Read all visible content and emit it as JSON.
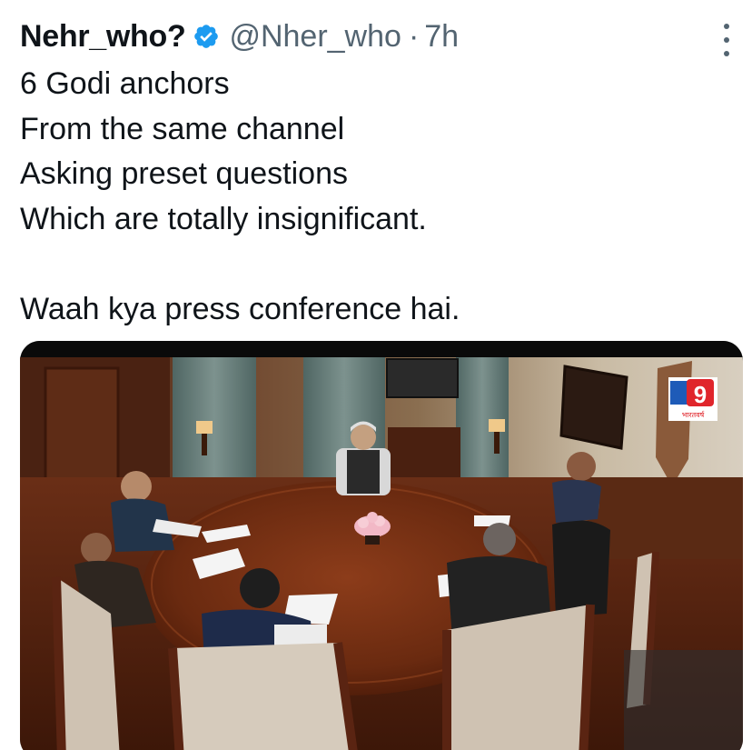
{
  "tweet": {
    "author": {
      "display_name": "Nehr_who?",
      "handle": "@Nher_who",
      "verified": true,
      "verified_icon": "verified-badge-icon"
    },
    "separator": "·",
    "time": "7h",
    "more_icon": "more-options-icon",
    "text_lines": [
      "6 Godi anchors",
      "From the same channel",
      "Asking preset questions",
      "Which are totally insignificant.",
      "",
      "Waah kya press conference hai."
    ],
    "media": {
      "type": "photo",
      "logo": {
        "brand": "9",
        "subtitle": "भारतवर्ष"
      }
    }
  },
  "colors": {
    "text_primary": "#0f1419",
    "text_secondary": "#536471",
    "verified": "#1d9bf0",
    "logo_red": "#e0252b",
    "logo_blue": "#1e5bb8"
  }
}
